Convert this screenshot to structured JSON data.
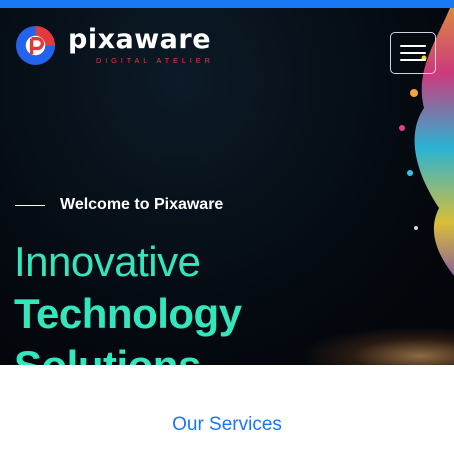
{
  "brand": {
    "name": "pixaware",
    "tagline": "DIGITAL ATELIER"
  },
  "colors": {
    "topbar": "#1877f2",
    "accent_heading": "#34e6bc",
    "link_blue": "#1877f2",
    "logo_red": "#e23a3a"
  },
  "hero": {
    "welcome": "Welcome to Pixaware",
    "heading_line1": "Innovative",
    "heading_line2": "Technology",
    "heading_line3": "Solutions"
  },
  "icons": {
    "menu": "hamburger-menu-icon",
    "logo": "pixaware-logo-icon"
  },
  "section": {
    "title": "Our Services"
  }
}
